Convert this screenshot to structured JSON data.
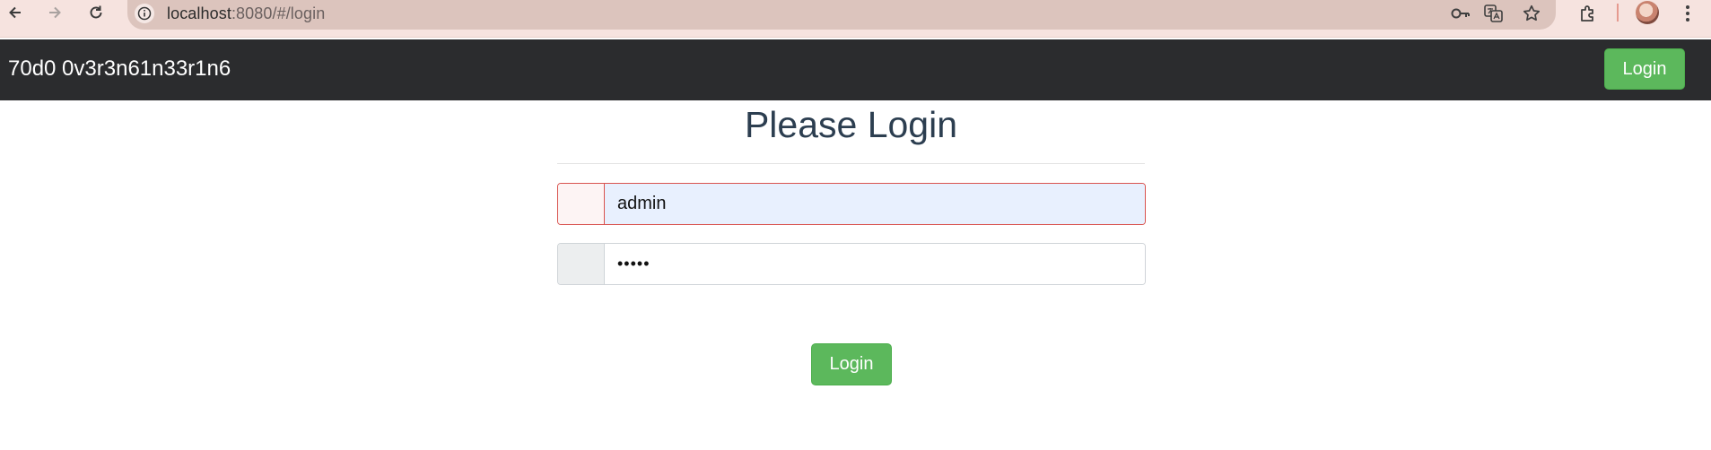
{
  "browser": {
    "url_host": "localhost",
    "url_path": ":8080/#/login"
  },
  "navbar": {
    "brand": "70d0 0v3r3n61n33r1n6",
    "login_label": "Login"
  },
  "form": {
    "title": "Please Login",
    "username_value": "admin",
    "password_value": "•••••",
    "submit_label": "Login"
  },
  "colors": {
    "navbar_bg": "#2b2c2e",
    "success": "#5cb85c",
    "error_border": "#d9534f",
    "autofill_bg": "#e8f0fe",
    "title_text": "#2c3e50"
  }
}
